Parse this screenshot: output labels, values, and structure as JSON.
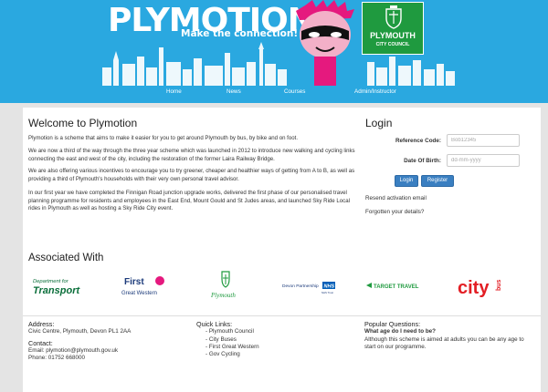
{
  "header": {
    "brand": "PLYMOTION",
    "tagline": "Make the connection!",
    "council_name": "PLYMOUTH",
    "council_sub": "CITY COUNCIL"
  },
  "nav": {
    "items": [
      {
        "label": "Home"
      },
      {
        "label": "News"
      },
      {
        "label": "Courses"
      },
      {
        "label": "Admin/Instructor"
      }
    ]
  },
  "welcome": {
    "title": "Welcome to Plymotion",
    "paragraphs": [
      "Plymotion is a scheme that aims to make it easier for you to get around Plymouth by bus, by bike and on foot.",
      "We are now a third of the way through the three year scheme which was launched in 2012 to introduce new walking and cycling links connecting the east and west of the city, including the restoration of the former Laira Railway Bridge.",
      "We are also offering various incentives to encourage you to try greener, cheaper and healthier ways of getting from A to B, as well as providing a third of Plymouth's households with their very own personal travel advisor.",
      "In our first year we have completed the Finnigan Road junction upgrade works, delivered the first phase of our personalised travel planning programme for residents and employees in the East End, Mount Gould and St Judes areas, and launched Sky Ride Local rides in Plymouth as well as hosting a Sky Ride City event."
    ]
  },
  "login": {
    "title": "Login",
    "ref_label": "Reference Code:",
    "ref_placeholder": "Bob12345",
    "dob_label": "Date Of Birth:",
    "dob_placeholder": "dd-mm-yyyy",
    "login_button": "Login",
    "register_button": "Register",
    "resend_link": "Resend activation email",
    "forgotten_link": "Forgotten your details?"
  },
  "associated": {
    "title": "Associated With",
    "logos": [
      {
        "line1": "Department for",
        "line2": "Transport",
        "color": "#0a6e3a"
      },
      {
        "line1": "First",
        "line2": "Great Western",
        "color": "#1b3a7a"
      },
      {
        "line1": "Plymouth",
        "color": "#1f9a3f"
      },
      {
        "line1": "Devon Partnership",
        "badge": "NHS",
        "line2": "NHS Trust",
        "color": "#1b3a7a"
      },
      {
        "line1": "TARGET TRAVEL",
        "color": "#1f9a3f"
      },
      {
        "line1": "city",
        "line2": "bus",
        "color": "#e31e24"
      }
    ]
  },
  "footer": {
    "address_title": "Address:",
    "address": "Civic Centre, Plymouth, Devon PL1 2AA",
    "contact_title": "Contact:",
    "email": "Email: plymotion@plymouth.gov.uk",
    "phone": "Phone: 01752 668000",
    "quick_title": "Quick Links:",
    "quick_links": [
      "- Plymouth Council",
      "- City Buses",
      "- First Great Western",
      "- Gov Cycling"
    ],
    "popular_title": "Popular Questions:",
    "question": "What age do I need to be?",
    "answer": "Although this scheme is aimed at adults you can be any age to start on our programme."
  },
  "colors": {
    "header_blue": "#2aa8e0",
    "council_green": "#1f9a3f",
    "button_blue": "#3a7fc1",
    "mascot_pink": "#e5197e"
  }
}
